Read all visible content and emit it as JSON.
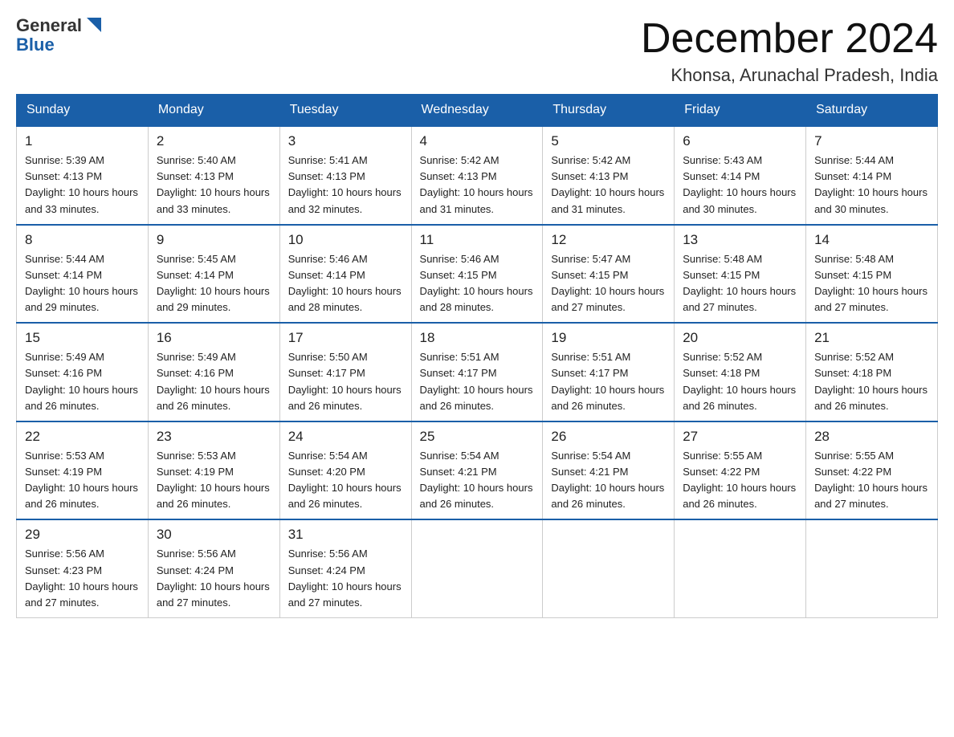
{
  "header": {
    "logo_general": "General",
    "logo_blue": "Blue",
    "month_title": "December 2024",
    "location": "Khonsa, Arunachal Pradesh, India"
  },
  "weekdays": [
    "Sunday",
    "Monday",
    "Tuesday",
    "Wednesday",
    "Thursday",
    "Friday",
    "Saturday"
  ],
  "weeks": [
    [
      {
        "day": "1",
        "sunrise": "5:39 AM",
        "sunset": "4:13 PM",
        "daylight": "10 hours and 33 minutes."
      },
      {
        "day": "2",
        "sunrise": "5:40 AM",
        "sunset": "4:13 PM",
        "daylight": "10 hours and 33 minutes."
      },
      {
        "day": "3",
        "sunrise": "5:41 AM",
        "sunset": "4:13 PM",
        "daylight": "10 hours and 32 minutes."
      },
      {
        "day": "4",
        "sunrise": "5:42 AM",
        "sunset": "4:13 PM",
        "daylight": "10 hours and 31 minutes."
      },
      {
        "day": "5",
        "sunrise": "5:42 AM",
        "sunset": "4:13 PM",
        "daylight": "10 hours and 31 minutes."
      },
      {
        "day": "6",
        "sunrise": "5:43 AM",
        "sunset": "4:14 PM",
        "daylight": "10 hours and 30 minutes."
      },
      {
        "day": "7",
        "sunrise": "5:44 AM",
        "sunset": "4:14 PM",
        "daylight": "10 hours and 30 minutes."
      }
    ],
    [
      {
        "day": "8",
        "sunrise": "5:44 AM",
        "sunset": "4:14 PM",
        "daylight": "10 hours and 29 minutes."
      },
      {
        "day": "9",
        "sunrise": "5:45 AM",
        "sunset": "4:14 PM",
        "daylight": "10 hours and 29 minutes."
      },
      {
        "day": "10",
        "sunrise": "5:46 AM",
        "sunset": "4:14 PM",
        "daylight": "10 hours and 28 minutes."
      },
      {
        "day": "11",
        "sunrise": "5:46 AM",
        "sunset": "4:15 PM",
        "daylight": "10 hours and 28 minutes."
      },
      {
        "day": "12",
        "sunrise": "5:47 AM",
        "sunset": "4:15 PM",
        "daylight": "10 hours and 27 minutes."
      },
      {
        "day": "13",
        "sunrise": "5:48 AM",
        "sunset": "4:15 PM",
        "daylight": "10 hours and 27 minutes."
      },
      {
        "day": "14",
        "sunrise": "5:48 AM",
        "sunset": "4:15 PM",
        "daylight": "10 hours and 27 minutes."
      }
    ],
    [
      {
        "day": "15",
        "sunrise": "5:49 AM",
        "sunset": "4:16 PM",
        "daylight": "10 hours and 26 minutes."
      },
      {
        "day": "16",
        "sunrise": "5:49 AM",
        "sunset": "4:16 PM",
        "daylight": "10 hours and 26 minutes."
      },
      {
        "day": "17",
        "sunrise": "5:50 AM",
        "sunset": "4:17 PM",
        "daylight": "10 hours and 26 minutes."
      },
      {
        "day": "18",
        "sunrise": "5:51 AM",
        "sunset": "4:17 PM",
        "daylight": "10 hours and 26 minutes."
      },
      {
        "day": "19",
        "sunrise": "5:51 AM",
        "sunset": "4:17 PM",
        "daylight": "10 hours and 26 minutes."
      },
      {
        "day": "20",
        "sunrise": "5:52 AM",
        "sunset": "4:18 PM",
        "daylight": "10 hours and 26 minutes."
      },
      {
        "day": "21",
        "sunrise": "5:52 AM",
        "sunset": "4:18 PM",
        "daylight": "10 hours and 26 minutes."
      }
    ],
    [
      {
        "day": "22",
        "sunrise": "5:53 AM",
        "sunset": "4:19 PM",
        "daylight": "10 hours and 26 minutes."
      },
      {
        "day": "23",
        "sunrise": "5:53 AM",
        "sunset": "4:19 PM",
        "daylight": "10 hours and 26 minutes."
      },
      {
        "day": "24",
        "sunrise": "5:54 AM",
        "sunset": "4:20 PM",
        "daylight": "10 hours and 26 minutes."
      },
      {
        "day": "25",
        "sunrise": "5:54 AM",
        "sunset": "4:21 PM",
        "daylight": "10 hours and 26 minutes."
      },
      {
        "day": "26",
        "sunrise": "5:54 AM",
        "sunset": "4:21 PM",
        "daylight": "10 hours and 26 minutes."
      },
      {
        "day": "27",
        "sunrise": "5:55 AM",
        "sunset": "4:22 PM",
        "daylight": "10 hours and 26 minutes."
      },
      {
        "day": "28",
        "sunrise": "5:55 AM",
        "sunset": "4:22 PM",
        "daylight": "10 hours and 27 minutes."
      }
    ],
    [
      {
        "day": "29",
        "sunrise": "5:56 AM",
        "sunset": "4:23 PM",
        "daylight": "10 hours and 27 minutes."
      },
      {
        "day": "30",
        "sunrise": "5:56 AM",
        "sunset": "4:24 PM",
        "daylight": "10 hours and 27 minutes."
      },
      {
        "day": "31",
        "sunrise": "5:56 AM",
        "sunset": "4:24 PM",
        "daylight": "10 hours and 27 minutes."
      },
      null,
      null,
      null,
      null
    ]
  ],
  "labels": {
    "sunrise": "Sunrise:",
    "sunset": "Sunset:",
    "daylight": "Daylight:"
  }
}
